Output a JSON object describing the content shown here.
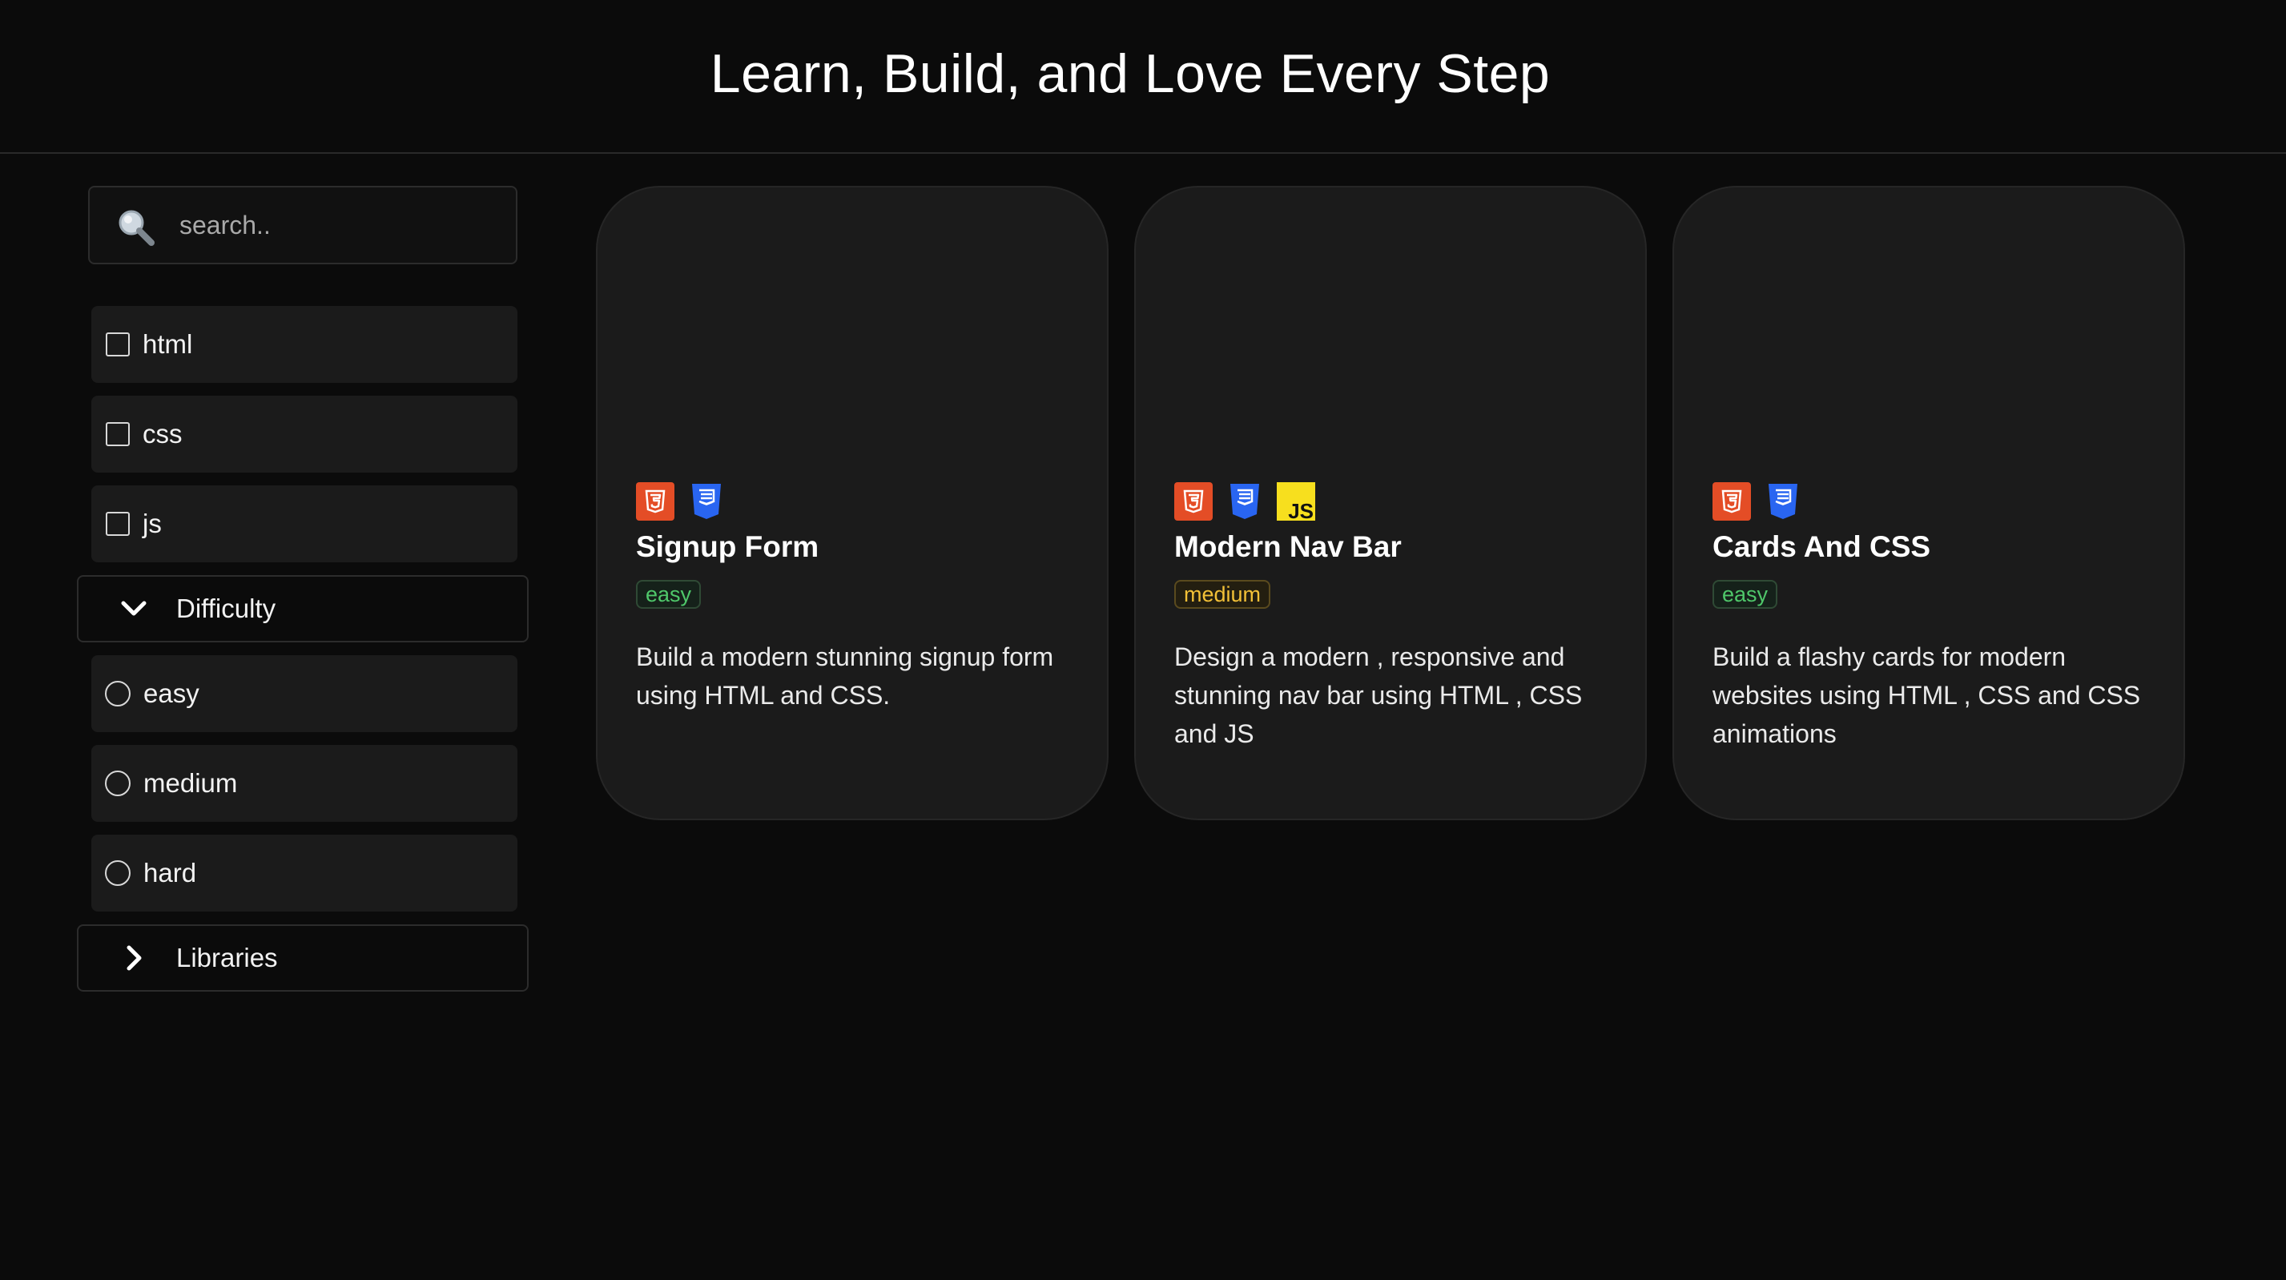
{
  "header": {
    "title": "Learn, Build, and Love Every Step"
  },
  "sidebar": {
    "search": {
      "placeholder": "search.."
    },
    "tech_filters": [
      {
        "label": "html"
      },
      {
        "label": "css"
      },
      {
        "label": "js"
      }
    ],
    "difficulty": {
      "label": "Difficulty",
      "expanded": true,
      "options": [
        {
          "label": "easy"
        },
        {
          "label": "medium"
        },
        {
          "label": "hard"
        }
      ]
    },
    "libraries": {
      "label": "Libraries",
      "expanded": false
    }
  },
  "cards": [
    {
      "title": "Signup Form",
      "difficulty": "easy",
      "icons": [
        "html5-icon",
        "css3-icon"
      ],
      "description": "Build a modern stunning signup form using HTML and CSS."
    },
    {
      "title": "Modern Nav Bar",
      "difficulty": "medium",
      "icons": [
        "html5-icon",
        "css3-icon",
        "javascript-icon"
      ],
      "description": "Design a modern , responsive and stunning nav bar using HTML , CSS and JS"
    },
    {
      "title": "Cards And CSS",
      "difficulty": "easy",
      "icons": [
        "html5-icon",
        "css3-icon"
      ],
      "description": "Build a flashy cards for modern websites using HTML , CSS and CSS animations"
    }
  ],
  "colors": {
    "background": "#0b0b0b",
    "card": "#1b1b1b",
    "html": "#e44d26",
    "css": "#2965f1",
    "js": "#f7df1e",
    "easy": "#4fc76a",
    "medium": "#f2c037"
  }
}
